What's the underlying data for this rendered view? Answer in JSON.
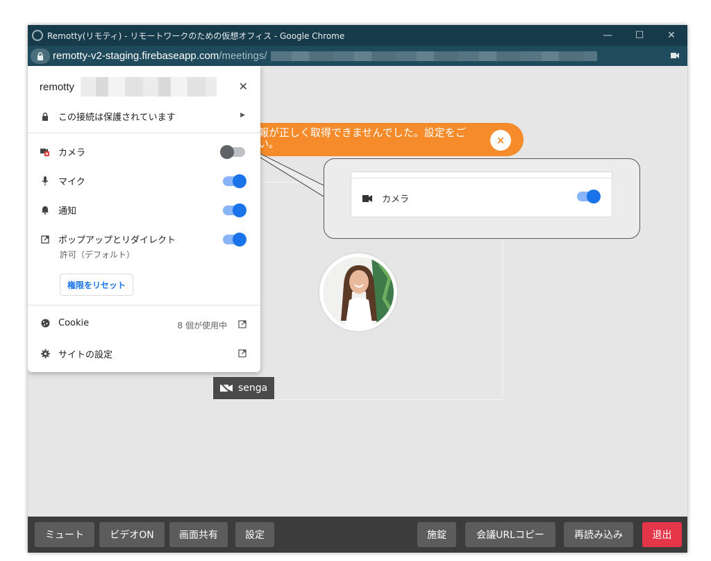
{
  "window": {
    "title": "Remotty(リモティ) - リモートワークのための仮想オフィス - Google Chrome",
    "controls": {
      "minimize": "—",
      "maximize": "☐",
      "close": "✕"
    }
  },
  "address_bar": {
    "host": "remotty-v2-staging.firebaseapp.com",
    "path": "/meetings/"
  },
  "site_popup": {
    "site_name": "remotty",
    "close": "✕",
    "connection": "この接続は保護されています",
    "permissions": [
      {
        "label": "カメラ",
        "icon": "camera-blocked-icon",
        "enabled": false
      },
      {
        "label": "マイク",
        "icon": "microphone-icon",
        "enabled": true
      },
      {
        "label": "通知",
        "icon": "bell-icon",
        "enabled": true
      },
      {
        "label": "ポップアップとリダイレクト",
        "icon": "popup-icon",
        "enabled": true,
        "sub": "許可（デフォルト）"
      }
    ],
    "reset_button": "権限をリセット",
    "cookie": {
      "label": "Cookie",
      "count": "8 個が使用中"
    },
    "site_settings": "サイトの設定"
  },
  "toast": {
    "text_line1": "報が正しく取得できませんでした。設定をご",
    "text_line2": "い。",
    "close": "×",
    "color": "#f58b2a"
  },
  "callout": {
    "label": "カメラ",
    "enabled": true
  },
  "participant": {
    "name": "senga",
    "video": "camera-off-icon"
  },
  "toolbar": {
    "buttons": [
      {
        "label": "ミュート"
      },
      {
        "label": "ビデオON"
      },
      {
        "label": "画面共有"
      },
      {
        "label": "設定"
      },
      {
        "label": "施錠"
      },
      {
        "label": "会議URLコピー"
      },
      {
        "label": "再読み込み"
      },
      {
        "label": "退出",
        "color": "#e53549"
      }
    ]
  },
  "colors": {
    "titlebar": "#173b4a",
    "addressbar": "#1f4b5c",
    "toggle_on": "#1a73e8",
    "toolbar_bg": "#3c3c3c"
  }
}
